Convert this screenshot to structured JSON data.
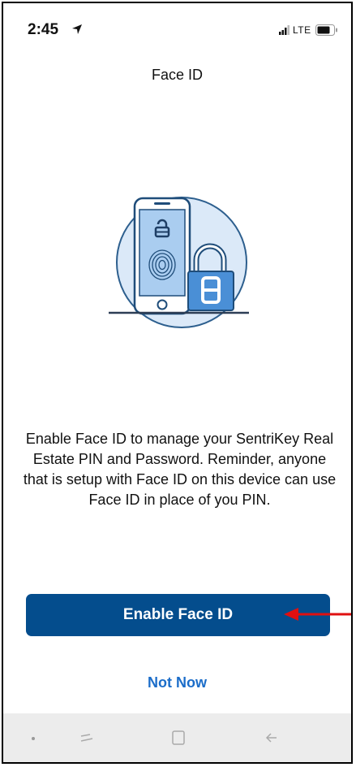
{
  "status_bar": {
    "time": "2:45",
    "network": "LTE"
  },
  "header": {
    "title": "Face ID"
  },
  "main": {
    "description": "Enable Face ID to manage your SentriKey Real Estate PIN and Password. Reminder, anyone that is setup with Face ID on this device can use Face ID in place of you PIN.",
    "primary_button": "Enable Face ID",
    "secondary_button": "Not Now"
  },
  "colors": {
    "primary": "#044d8d",
    "link": "#1b6dc9",
    "annotation_arrow": "#e01010",
    "illustration": "#4a8fd6"
  },
  "icons": [
    "location-arrow-icon",
    "signal-icon",
    "battery-icon",
    "face-id-illustration",
    "recent-apps-icon",
    "home-icon",
    "back-icon"
  ]
}
